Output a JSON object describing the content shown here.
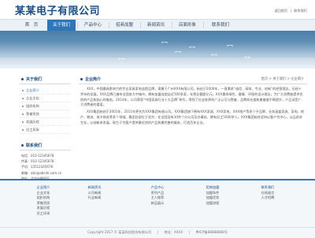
{
  "header": {
    "logo": "某某电子有限公司",
    "links": [
      "返回首页",
      "|",
      "联系我们"
    ]
  },
  "nav": {
    "items": [
      "首　页",
      "关于我们",
      "产品中心",
      "招商加盟",
      "新闻资讯",
      "店面形象",
      "联系我们"
    ],
    "active_index": 1
  },
  "sidebar": {
    "about_title": "关于我们",
    "items": [
      "企业简介",
      "企业文化",
      "组织机构",
      "荣誉资质",
      "发展历程",
      "员工风采"
    ],
    "active_index": 0,
    "contact_title": "联系我们",
    "contact_lines": [
      "电话：010-12345678",
      "传真：010-12345678",
      "手机：13512345678",
      "邮箱：abc@abcde.com.cn",
      "地址：北京市朝阳区",
      "网址：北京市朝阳区XXXX大厦1楼",
      "联系人：张先生"
    ]
  },
  "breadcrumb": {
    "title": "企业简介",
    "path": "首页  >  关于我们  >  企业简介"
  },
  "content": {
    "paragraphs": [
      "XXX，中国最具影响力的专业家具家电连锁品牌，隶属于广州XXX有限公司，始创于2000年，一直秉承“诚信、高效、专业、创新”的经营理念，历经十余年的发展，XXX品牌已遍布全国各大中城市，拥有加盟连锁店近500多家，年营业额超亿元。XXX秉承绿色、健康、环保的设计理念，为广大消费者提供优质的产品和贴心的服务。2014年，公司荣获“中国家具行业十大品牌”称号，得到了社会各界的广泛认可与赞誉，品牌知名度和美誉度不断提升，产品深受广大消费者的喜爱。",
      "XXX集团始创于2001年，2011年更名为XXX集团有限公司。XXX集团旗下拥有XXX家具、XXX家电、XXX地产等多个子品牌，业务涵盖家具、家电、地产、物流、电子商务等多个领域。集团总部位于北京，在全国设有30余个分公司及办事处，拥有员工5000余人。XXX集团始终坚持以客户为中心，以品质求生存，以创新求发展，致力于为客户提供最优质的产品和最完善的服务，打造百年企业。"
    ]
  },
  "footer": {
    "columns": [
      {
        "head": "企业简介",
        "items": [
          "企业文化",
          "组织机构",
          "荣誉资质",
          "发展历程",
          "员工风采"
        ]
      },
      {
        "head": "新闻资讯",
        "items": [
          "公司新闻",
          "行业新闻"
        ]
      },
      {
        "head": "产品中心",
        "items": [
          "系列产品",
          "主人推荐",
          "新品展示"
        ]
      },
      {
        "head": "招商加盟",
        "items": [
          "加盟条件",
          "加盟优势",
          "加盟流程"
        ]
      },
      {
        "head": "联系我们",
        "items": [
          "在线留言",
          "人才招聘"
        ]
      }
    ],
    "copyright": [
      "Copyright 2017 © 某某科技股份有限公司",
      "|",
      "地址：XXXX",
      "|",
      "粤ICP备88888888号"
    ]
  }
}
